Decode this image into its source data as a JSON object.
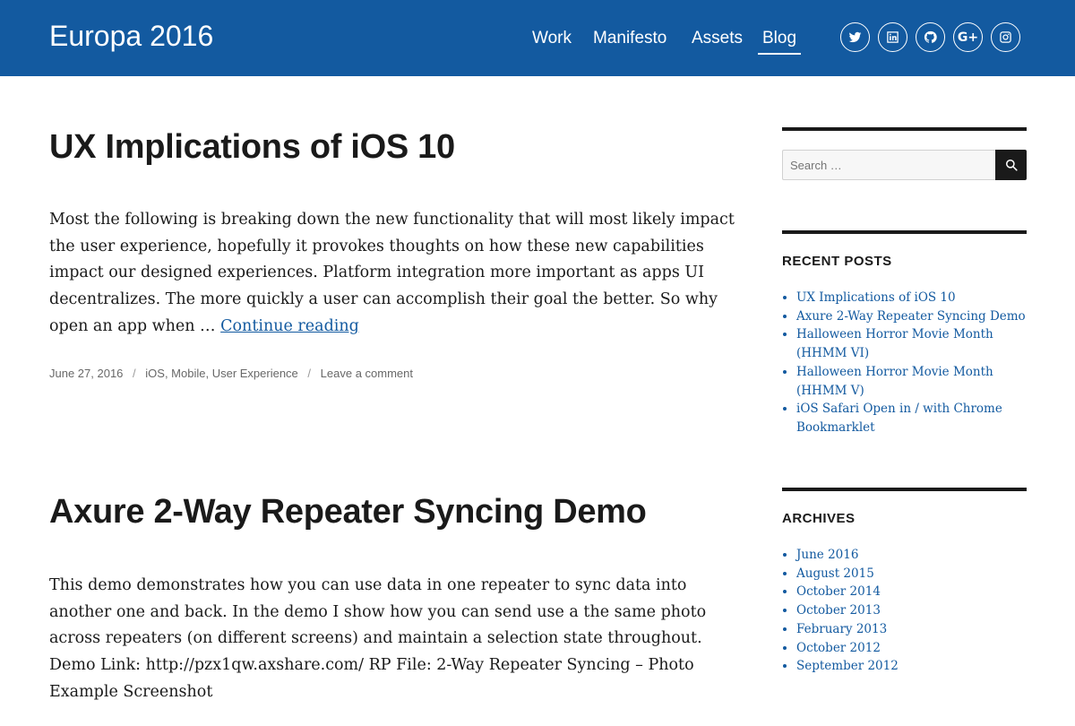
{
  "site": {
    "title": "Europa 2016"
  },
  "nav": {
    "items": [
      {
        "label": "Work"
      },
      {
        "label": "Manifesto"
      },
      {
        "label": "Assets"
      },
      {
        "label": "Blog"
      }
    ]
  },
  "social": {
    "icons": [
      "twitter-icon",
      "linkedin-icon",
      "github-icon",
      "google-plus-icon",
      "instagram-icon"
    ],
    "google_plus_glyph": "G+"
  },
  "posts": [
    {
      "title": "UX Implications of iOS 10",
      "excerpt": "Most the following is breaking down the new functionality that will most likely impact the user experience, hopefully it provokes thoughts on how these new capabilities impact our designed experiences. Platform integration more important as apps UI decentralizes. The more quickly a user can accomplish their goal the better. So why open an app when …",
      "continue_label": "Continue reading",
      "date": "June 27, 2016",
      "categories": "iOS, Mobile, User Experience",
      "comment_label": "Leave a comment"
    },
    {
      "title": "Axure 2-Way Repeater Syncing Demo",
      "excerpt": "This demo demonstrates how you can use data in one repeater to sync data into another one and back. In the demo I show how you can send use a the same photo across repeaters (on different screens) and maintain a selection state throughout. Demo Link: http://pzx1qw.axshare.com/ RP File: 2-Way Repeater Syncing – Photo Example Screenshot"
    }
  ],
  "sidebar": {
    "search": {
      "placeholder": "Search …"
    },
    "recent_posts": {
      "title": "RECENT POSTS",
      "items": [
        "UX Implications of iOS 10",
        "Axure 2-Way Repeater Syncing Demo",
        "Halloween Horror Movie Month (HHMM VI)",
        "Halloween Horror Movie Month (HHMM V)",
        "iOS Safari Open in / with Chrome Bookmarklet"
      ]
    },
    "archives": {
      "title": "ARCHIVES",
      "items": [
        "June 2016",
        "August 2015",
        "October 2014",
        "October 2013",
        "February 2013",
        "October 2012",
        "September 2012"
      ]
    }
  },
  "colors": {
    "header_bg": "#135aa0",
    "link": "#135aa0",
    "text": "#1a1a1a",
    "meta": "#686868"
  }
}
